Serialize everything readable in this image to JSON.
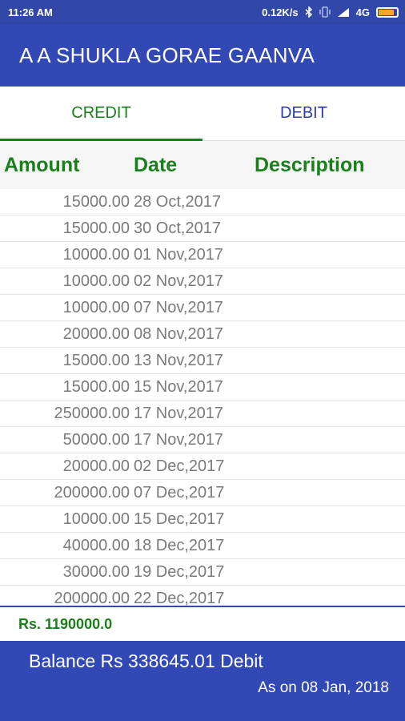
{
  "status_bar": {
    "time": "11:26 AM",
    "speed": "0.12K/s",
    "network": "4G",
    "icons": [
      "bluetooth-icon",
      "vibrate-icon",
      "signal-icon",
      "battery-icon"
    ],
    "battery_color": "#f2a634"
  },
  "app_bar": {
    "title": "A A SHUKLA GORAE GAANVA",
    "color": "#3249b5"
  },
  "tabs": {
    "credit": "CREDIT",
    "debit": "DEBIT",
    "active": "CREDIT",
    "credit_color": "#1b7f1b",
    "debit_color": "#2c3ea8"
  },
  "table": {
    "headers": {
      "amount": "Amount",
      "date": "Date",
      "description": "Description"
    },
    "rows": [
      {
        "amount": "15000.00",
        "date": "28 Oct,2017",
        "description": ""
      },
      {
        "amount": "15000.00",
        "date": "30 Oct,2017",
        "description": ""
      },
      {
        "amount": "10000.00",
        "date": "01 Nov,2017",
        "description": ""
      },
      {
        "amount": "10000.00",
        "date": "02 Nov,2017",
        "description": ""
      },
      {
        "amount": "10000.00",
        "date": "07 Nov,2017",
        "description": ""
      },
      {
        "amount": "20000.00",
        "date": "08 Nov,2017",
        "description": ""
      },
      {
        "amount": "15000.00",
        "date": "13 Nov,2017",
        "description": ""
      },
      {
        "amount": "15000.00",
        "date": "15 Nov,2017",
        "description": ""
      },
      {
        "amount": "250000.00",
        "date": "17 Nov,2017",
        "description": ""
      },
      {
        "amount": "50000.00",
        "date": "17 Nov,2017",
        "description": ""
      },
      {
        "amount": "20000.00",
        "date": "02 Dec,2017",
        "description": ""
      },
      {
        "amount": "200000.00",
        "date": "07 Dec,2017",
        "description": ""
      },
      {
        "amount": "10000.00",
        "date": "15 Dec,2017",
        "description": ""
      },
      {
        "amount": "40000.00",
        "date": "18 Dec,2017",
        "description": ""
      },
      {
        "amount": "30000.00",
        "date": "19 Dec,2017",
        "description": ""
      },
      {
        "amount": "200000.00",
        "date": "22 Dec,2017",
        "description": ""
      }
    ]
  },
  "total": {
    "text": "Rs. 1190000.0"
  },
  "footer": {
    "balance": "Balance Rs 338645.01 Debit",
    "as_on": "As on 08 Jan, 2018"
  }
}
